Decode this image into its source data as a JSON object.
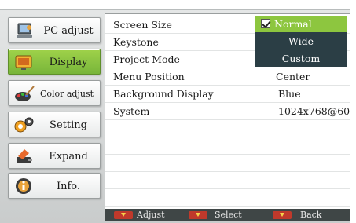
{
  "sidebar": {
    "items": [
      {
        "label": "PC adjust",
        "icon": "pc-adjust-icon"
      },
      {
        "label": "Display",
        "icon": "display-icon"
      },
      {
        "label": "Color adjust",
        "icon": "color-adjust-icon"
      },
      {
        "label": "Setting",
        "icon": "setting-icon"
      },
      {
        "label": "Expand",
        "icon": "expand-icon"
      },
      {
        "label": "Info.",
        "icon": "info-icon"
      }
    ],
    "active_index": 1
  },
  "panel": {
    "rows": [
      {
        "name": "Screen Size",
        "value": ""
      },
      {
        "name": "Keystone",
        "value": ""
      },
      {
        "name": "Project Mode",
        "value": ""
      },
      {
        "name": "Menu Position",
        "value": "Center"
      },
      {
        "name": "Background Display",
        "value": "Blue"
      },
      {
        "name": "System",
        "value": "1024x768@60"
      }
    ]
  },
  "dropdown": {
    "options": [
      "Normal",
      "Wide",
      "Custom"
    ],
    "selected": "Normal"
  },
  "footer": {
    "adjust_label": "Adjust",
    "select_label": "Select",
    "back_label": "Back"
  },
  "colors": {
    "accent_green": "#8dc63f",
    "dropdown_bg": "#2b3e45",
    "footer_bg": "#3f4646",
    "key_red": "#c0392b"
  }
}
